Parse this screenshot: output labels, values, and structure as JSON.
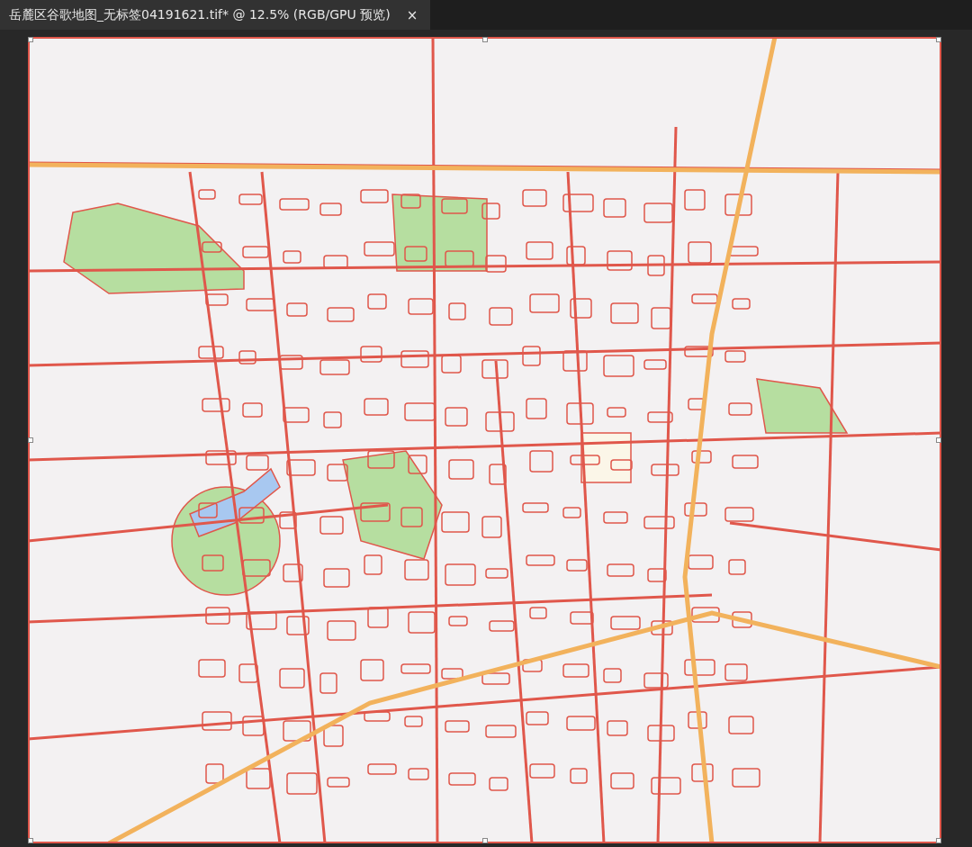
{
  "document_tab": {
    "title": "岳麓区谷歌地图_无标签04191621.tif* @ 12.5% (RGB/GPU 预览)",
    "close": "×",
    "selected": true
  }
}
